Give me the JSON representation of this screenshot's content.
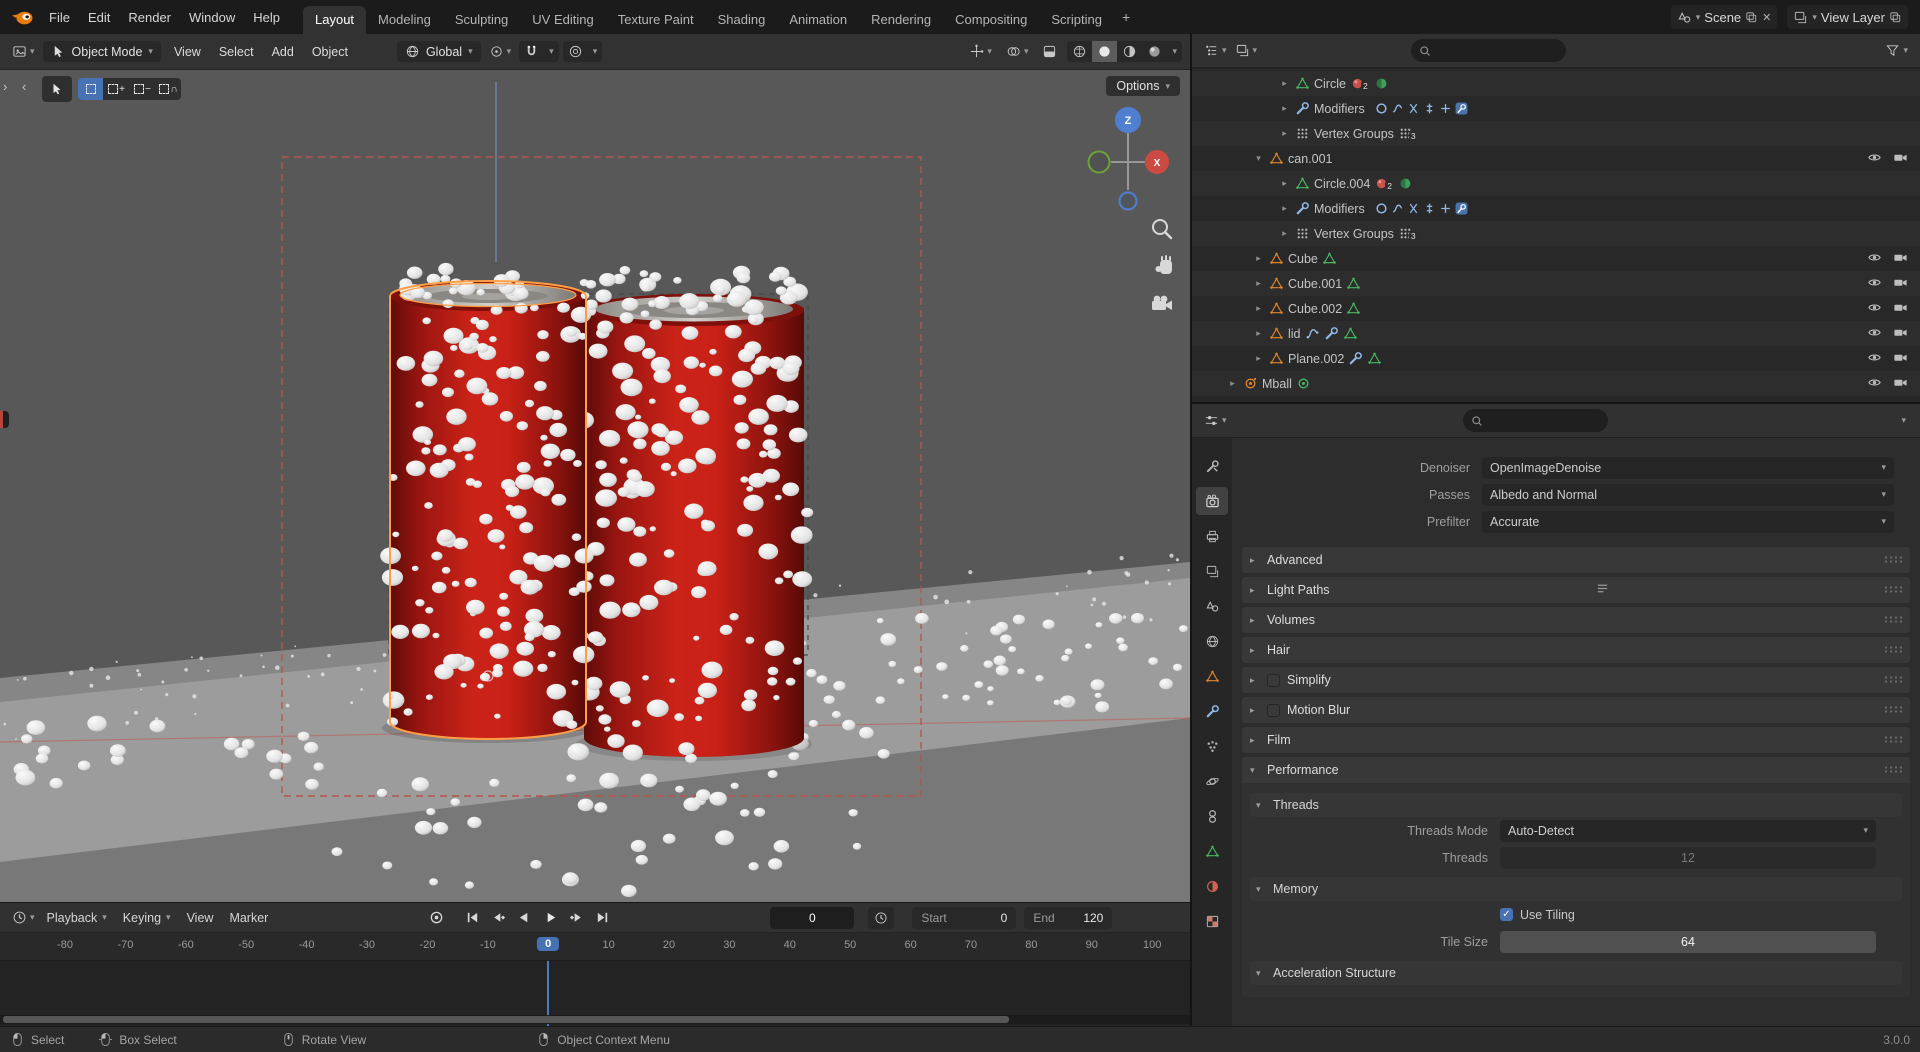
{
  "colors": {
    "accent": "#4772b3",
    "object_orange": "#e0862c",
    "mesh_green": "#49b860",
    "modifier_blue": "#8fb6e3",
    "can_red": "#c62319"
  },
  "topbar": {
    "menus": [
      "File",
      "Edit",
      "Render",
      "Window",
      "Help"
    ],
    "workspaces": [
      "Layout",
      "Modeling",
      "Sculpting",
      "UV Editing",
      "Texture Paint",
      "Shading",
      "Animation",
      "Rendering",
      "Compositing",
      "Scripting"
    ],
    "active_workspace": "Layout",
    "new_workspace": "+",
    "scene_label": "Scene",
    "view_layer_label": "View Layer"
  },
  "viewport": {
    "mode": "Object Mode",
    "menus": [
      "View",
      "Select",
      "Add",
      "Object"
    ],
    "orientation": "Global",
    "options_label": "Options",
    "axis_z": "Z",
    "axis_x": "X"
  },
  "outliner": {
    "rows": [
      {
        "label": "Circle",
        "depth": 2,
        "arrow": "collapsed",
        "icon": "mesh",
        "extras": [
          "material2",
          "texture"
        ],
        "vis": false
      },
      {
        "label": "Modifiers",
        "depth": 2,
        "arrow": "collapsed",
        "icon": "wrench",
        "extras": [
          "modstack"
        ],
        "vis": false
      },
      {
        "label": "Vertex Groups",
        "depth": 2,
        "arrow": "collapsed",
        "icon": "vgroup",
        "extras": [
          "vgroup3"
        ],
        "vis": false
      },
      {
        "label": "can.001",
        "depth": 1,
        "arrow": "expanded",
        "icon": "object",
        "extras": [],
        "vis": true
      },
      {
        "label": "Circle.004",
        "depth": 2,
        "arrow": "collapsed",
        "icon": "mesh",
        "extras": [
          "material2",
          "texture"
        ],
        "vis": false
      },
      {
        "label": "Modifiers",
        "depth": 2,
        "arrow": "collapsed",
        "icon": "wrench",
        "extras": [
          "modstack"
        ],
        "vis": false
      },
      {
        "label": "Vertex Groups",
        "depth": 2,
        "arrow": "collapsed",
        "icon": "vgroup",
        "extras": [
          "vgroup3"
        ],
        "vis": false
      },
      {
        "label": "Cube",
        "depth": 1,
        "arrow": "collapsed",
        "icon": "object",
        "extras": [
          "mesh"
        ],
        "vis": true
      },
      {
        "label": "Cube.001",
        "depth": 1,
        "arrow": "collapsed",
        "icon": "object",
        "extras": [
          "mesh"
        ],
        "vis": true
      },
      {
        "label": "Cube.002",
        "depth": 1,
        "arrow": "collapsed",
        "icon": "object",
        "extras": [
          "mesh"
        ],
        "vis": true
      },
      {
        "label": "lid",
        "depth": 1,
        "arrow": "collapsed",
        "icon": "object",
        "extras": [
          "curve",
          "wrench",
          "mesh"
        ],
        "vis": true
      },
      {
        "label": "Plane.002",
        "depth": 1,
        "arrow": "collapsed",
        "icon": "object",
        "extras": [
          "wrench",
          "mesh"
        ],
        "vis": true
      },
      {
        "label": "Mball",
        "depth": 0,
        "arrow": "collapsed",
        "icon": "meta",
        "extras": [
          "metadata"
        ],
        "vis": true
      }
    ]
  },
  "properties": {
    "tabs": [
      {
        "icon": "tool",
        "active": false
      },
      {
        "icon": "render",
        "active": true
      },
      {
        "icon": "output",
        "active": false
      },
      {
        "icon": "view-layer",
        "active": false
      },
      {
        "icon": "scene",
        "active": false
      },
      {
        "icon": "world",
        "active": false
      },
      {
        "icon": "object",
        "active": false
      },
      {
        "icon": "modifiers",
        "active": false
      },
      {
        "icon": "particles",
        "active": false
      },
      {
        "icon": "physics",
        "active": false
      },
      {
        "icon": "constraints",
        "active": false
      },
      {
        "icon": "object-data",
        "active": false
      },
      {
        "icon": "material",
        "active": false
      },
      {
        "icon": "texture",
        "active": false
      }
    ],
    "fields": [
      {
        "label": "Denoiser",
        "value": "OpenImageDenoise"
      },
      {
        "label": "Passes",
        "value": "Albedo and Normal"
      },
      {
        "label": "Prefilter",
        "value": "Accurate"
      }
    ],
    "panels": [
      {
        "label": "Advanced",
        "preset": false,
        "checkbox": false
      },
      {
        "label": "Light Paths",
        "preset": true,
        "checkbox": false
      },
      {
        "label": "Volumes",
        "preset": false,
        "checkbox": false
      },
      {
        "label": "Hair",
        "preset": false,
        "checkbox": false
      },
      {
        "label": "Simplify",
        "preset": false,
        "checkbox": true,
        "checked": false
      },
      {
        "label": "Motion Blur",
        "preset": false,
        "checkbox": true,
        "checked": false
      },
      {
        "label": "Film",
        "preset": false,
        "checkbox": false
      }
    ],
    "performance": {
      "title": "Performance",
      "threads_title": "Threads",
      "threads_mode_label": "Threads Mode",
      "threads_mode_value": "Auto-Detect",
      "threads_label": "Threads",
      "threads_value": "12",
      "memory_title": "Memory",
      "use_tiling_label": "Use Tiling",
      "use_tiling_checked": true,
      "tile_size_label": "Tile Size",
      "tile_size_value": "64",
      "accel_title": "Acceleration Structure"
    }
  },
  "timeline": {
    "menus": [
      {
        "label": "Playback",
        "dropdown": true
      },
      {
        "label": "Keying",
        "dropdown": true
      },
      {
        "label": "View",
        "dropdown": false
      },
      {
        "label": "Marker",
        "dropdown": false
      }
    ],
    "transport": [
      "jump-start",
      "prev-key",
      "play-back",
      "play",
      "next-key",
      "jump-end"
    ],
    "current_frame": "0",
    "start_label": "Start",
    "start_value": "0",
    "end_label": "End",
    "end_value": "120",
    "ticks": [
      "-80",
      "-70",
      "-60",
      "-50",
      "-40",
      "-30",
      "-20",
      "-10",
      "0",
      "10",
      "20",
      "30",
      "40",
      "50",
      "60",
      "70",
      "80",
      "90",
      "100"
    ],
    "current_tick_index": 8
  },
  "statusbar": {
    "hints": [
      {
        "icon": "mouse-left",
        "label": "Select"
      },
      {
        "icon": "mouse-left-drag",
        "label": "Box Select"
      },
      {
        "icon": "mouse-middle",
        "label": "Rotate View"
      },
      {
        "icon": "mouse-right",
        "label": "Object Context Menu"
      }
    ],
    "version": "3.0.0"
  }
}
